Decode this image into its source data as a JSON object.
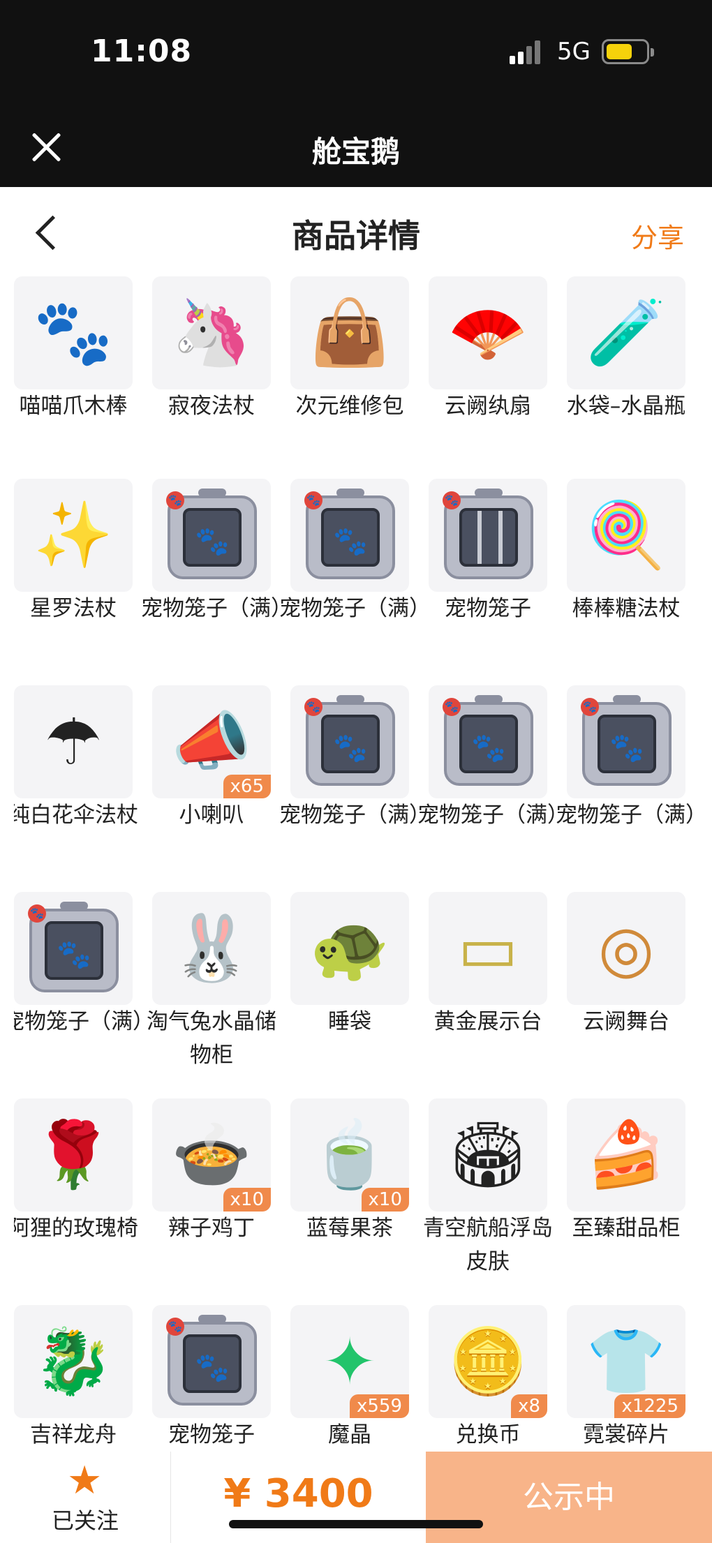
{
  "status": {
    "time": "11:08",
    "network": "5G"
  },
  "app": {
    "title": "舱宝鹅"
  },
  "header": {
    "title": "商品详情",
    "share": "分享"
  },
  "items": [
    {
      "name": "喵喵爪木棒",
      "icon": "paw-wand-icon",
      "badge": ""
    },
    {
      "name": "寂夜法杖",
      "icon": "pegasus-staff-icon",
      "badge": ""
    },
    {
      "name": "次元维修包",
      "icon": "repair-bag-icon",
      "badge": ""
    },
    {
      "name": "云阙纨扇",
      "icon": "round-fan-icon",
      "badge": ""
    },
    {
      "name": "水袋–水晶瓶",
      "icon": "crystal-bottle-icon",
      "badge": ""
    },
    {
      "name": "星罗法杖",
      "icon": "star-staff-icon",
      "badge": ""
    },
    {
      "name": "宠物笼子（满）",
      "icon": "pet-cage-full-icon",
      "badge": ""
    },
    {
      "name": "宠物笼子（满）",
      "icon": "pet-cage-full-icon",
      "badge": ""
    },
    {
      "name": "宠物笼子",
      "icon": "pet-cage-icon",
      "badge": ""
    },
    {
      "name": "棒棒糖法杖",
      "icon": "lollipop-staff-icon",
      "badge": ""
    },
    {
      "name": "纯白花伞法杖",
      "icon": "umbrella-staff-icon",
      "badge": ""
    },
    {
      "name": "小喇叭",
      "icon": "megaphone-icon",
      "badge": "x65"
    },
    {
      "name": "宠物笼子（满）",
      "icon": "pet-cage-full-icon",
      "badge": ""
    },
    {
      "name": "宠物笼子（满）",
      "icon": "pet-cage-full-icon",
      "badge": ""
    },
    {
      "name": "宠物笼子（满）",
      "icon": "pet-cage-full-icon",
      "badge": ""
    },
    {
      "name": "宠物笼子（满）",
      "icon": "pet-cage-full-icon",
      "badge": ""
    },
    {
      "name": "淘气兔水晶储物柜",
      "icon": "bunny-cabinet-icon",
      "badge": ""
    },
    {
      "name": "睡袋",
      "icon": "sleeping-bag-icon",
      "badge": ""
    },
    {
      "name": "黄金展示台",
      "icon": "display-platform-icon",
      "badge": ""
    },
    {
      "name": "云阙舞台",
      "icon": "round-stage-icon",
      "badge": ""
    },
    {
      "name": "阿狸的玫瑰椅",
      "icon": "rose-chair-icon",
      "badge": ""
    },
    {
      "name": "辣子鸡丁",
      "icon": "spicy-chicken-icon",
      "badge": "x10"
    },
    {
      "name": "蓝莓果茶",
      "icon": "blueberry-tea-icon",
      "badge": "x10"
    },
    {
      "name": "青空航船浮岛皮肤",
      "icon": "floating-island-icon",
      "badge": ""
    },
    {
      "name": "至臻甜品柜",
      "icon": "dessert-cabinet-icon",
      "badge": ""
    },
    {
      "name": "吉祥龙舟",
      "icon": "dragon-boat-icon",
      "badge": ""
    },
    {
      "name": "宠物笼子",
      "icon": "pet-cage-full-icon",
      "badge": ""
    },
    {
      "name": "魔晶",
      "icon": "magic-crystal-icon",
      "badge": "x559"
    },
    {
      "name": "兑换币",
      "icon": "exchange-coin-icon",
      "badge": "x8"
    },
    {
      "name": "霓裳碎片",
      "icon": "shirt-shard-icon",
      "badge": "x1225"
    }
  ],
  "bottom": {
    "follow_label": "已关注",
    "price": "¥ 3400",
    "cta": "公示中"
  }
}
